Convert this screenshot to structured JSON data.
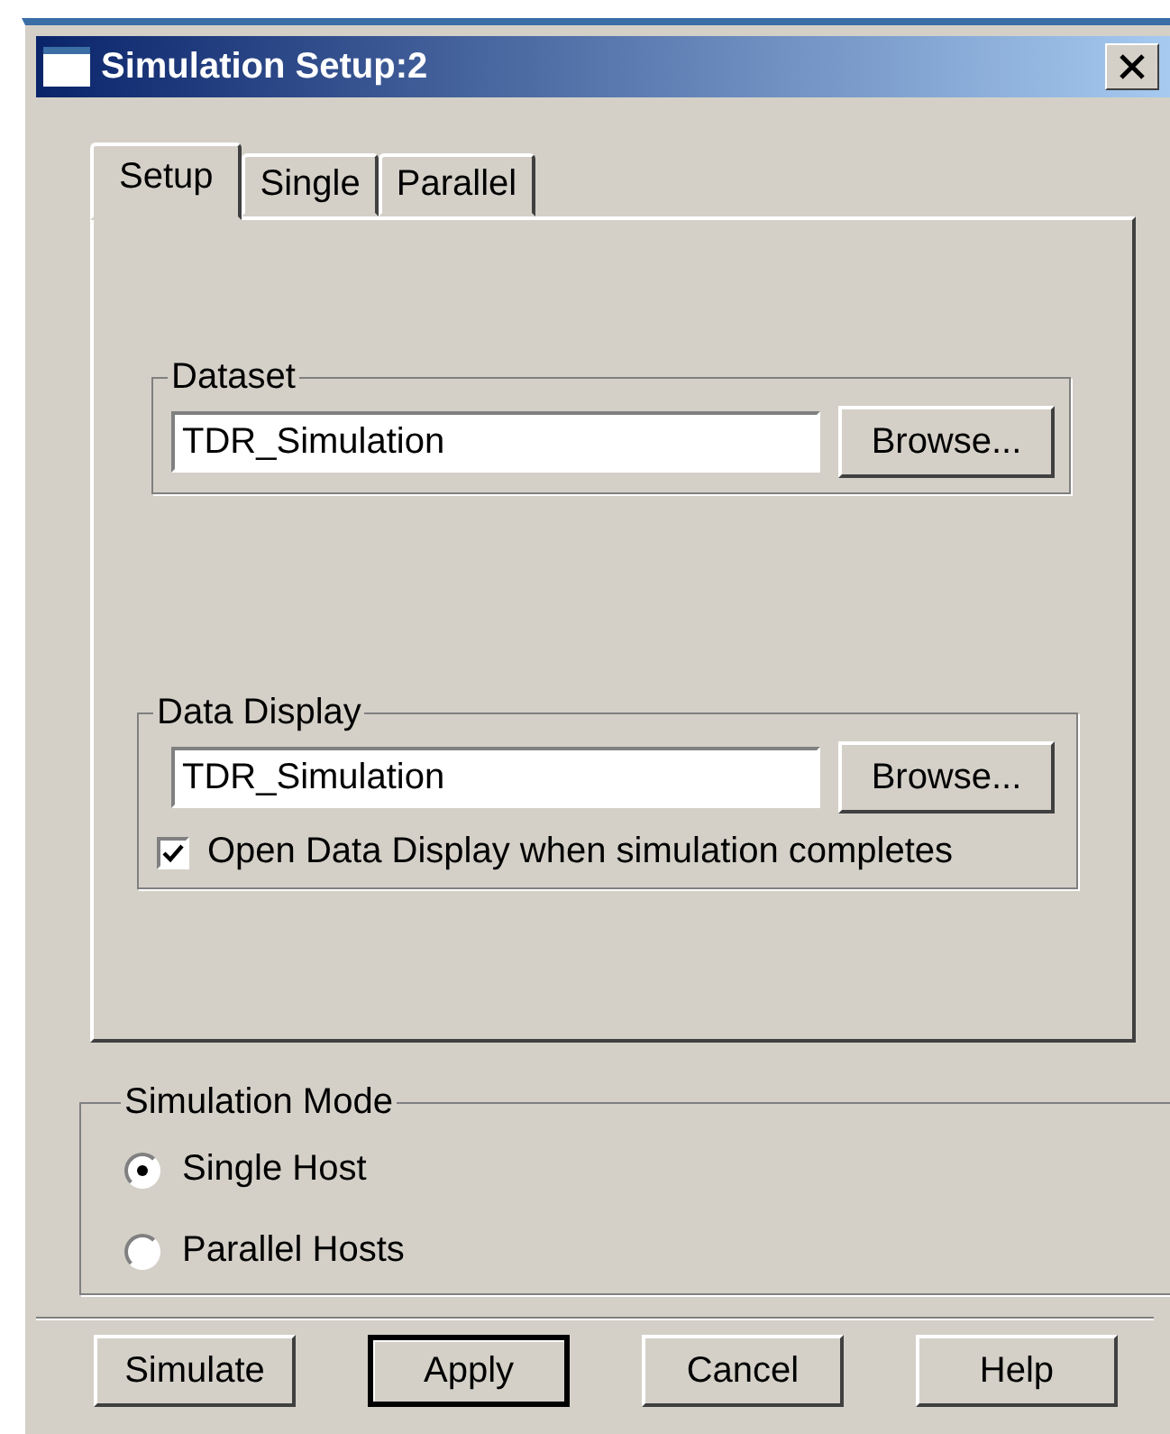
{
  "window": {
    "title": "Simulation Setup:2"
  },
  "tabs": [
    {
      "label": "Setup",
      "selected": true
    },
    {
      "label": "Single",
      "selected": false
    },
    {
      "label": "Parallel",
      "selected": false
    }
  ],
  "dataset": {
    "label": "Dataset",
    "value": "TDR_Simulation",
    "browse": "Browse..."
  },
  "data_display": {
    "label": "Data Display",
    "value": "TDR_Simulation",
    "browse": "Browse...",
    "open_when_complete": {
      "label": "Open Data Display when simulation completes",
      "checked": true
    }
  },
  "simulation_mode": {
    "label": "Simulation Mode",
    "options": [
      {
        "label": "Single Host",
        "selected": true
      },
      {
        "label": "Parallel Hosts",
        "selected": false
      }
    ]
  },
  "buttons": [
    {
      "label": "Simulate",
      "default": false
    },
    {
      "label": "Apply",
      "default": true
    },
    {
      "label": "Cancel",
      "default": false
    },
    {
      "label": "Help",
      "default": false
    }
  ]
}
